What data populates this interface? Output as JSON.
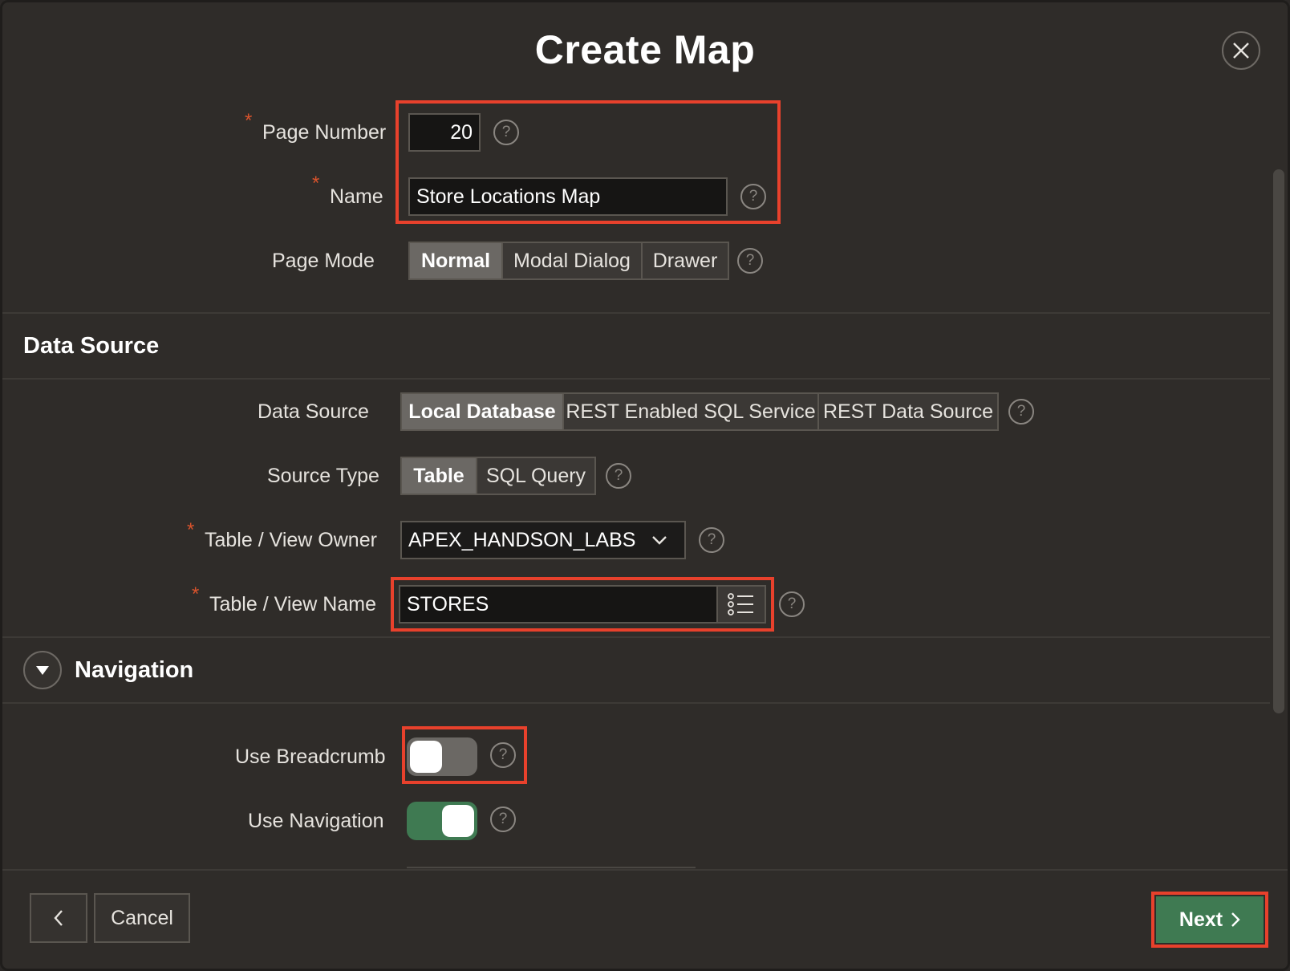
{
  "dialog": {
    "title": "Create Map",
    "close_icon": "close-icon"
  },
  "page": {
    "page_number_label": "Page Number",
    "page_number_value": "20",
    "name_label": "Name",
    "name_value": "Store Locations Map",
    "page_mode_label": "Page Mode",
    "page_mode_options": [
      "Normal",
      "Modal Dialog",
      "Drawer"
    ],
    "page_mode_selected": "Normal",
    "required_marker": "*",
    "help_glyph": "?"
  },
  "data_source_section": {
    "title": "Data Source",
    "data_source_label": "Data Source",
    "data_source_options": [
      "Local Database",
      "REST Enabled SQL Service",
      "REST Data Source"
    ],
    "data_source_selected": "Local Database",
    "source_type_label": "Source Type",
    "source_type_options": [
      "Table",
      "SQL Query"
    ],
    "source_type_selected": "Table",
    "owner_label": "Table / View Owner",
    "owner_value": "APEX_HANDSON_LABS",
    "table_name_label": "Table / View Name",
    "table_name_value": "STORES"
  },
  "navigation_section": {
    "title": "Navigation",
    "use_breadcrumb_label": "Use Breadcrumb",
    "use_breadcrumb_on": false,
    "use_navigation_label": "Use Navigation",
    "use_navigation_on": true
  },
  "footer": {
    "back_icon": "chevron-left-icon",
    "cancel_label": "Cancel",
    "next_label": "Next",
    "next_icon": "chevron-right-icon"
  },
  "colors": {
    "accent_green": "#3f7a52",
    "highlight_red": "#e8412c",
    "required_red": "#d9532c"
  }
}
